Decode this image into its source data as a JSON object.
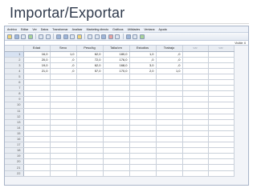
{
  "slide": {
    "title": "Importar/Exportar"
  },
  "app": {
    "menus": [
      "Archivo",
      "Editar",
      "Ver",
      "Datos",
      "Transformar",
      "Analizar",
      "Marketing directo",
      "Gráficos",
      "Utilidades",
      "Ventana",
      "Ayuda"
    ],
    "toolbar": [
      "open-icon",
      "save-icon",
      "print-icon",
      "dialog-recall-icon",
      "undo-icon",
      "redo-icon",
      "goto-case-icon",
      "goto-variable-icon",
      "variables-icon",
      "find-icon",
      "insert-cases-icon",
      "insert-variable-icon",
      "split-file-icon",
      "weight-cases-icon",
      "select-cases-icon",
      "value-labels-icon",
      "use-sets-icon",
      "show-all-icon"
    ],
    "visible_label": "Visible: 6 "
  },
  "grid": {
    "columns": [
      "Edad",
      "Sexo",
      "Peso/kg",
      "Talla/cm",
      "Estudios",
      "Trabajo",
      "var",
      "var"
    ],
    "rows": [
      [
        "16,0",
        "1,0",
        "62,0",
        "180,0",
        "1,0",
        ",0"
      ],
      [
        "20,0",
        ",0",
        "72,0",
        "176,0",
        ",0",
        ",0"
      ],
      [
        "19,0",
        ",0",
        "62,0",
        "168,0",
        "3,0",
        ",0"
      ],
      [
        "21,0",
        ",0",
        "57,0",
        "170,0",
        "2,0",
        "1,0"
      ]
    ],
    "row_numbers": [
      "1",
      "2",
      "3",
      "4",
      "5",
      "6",
      "7",
      "8",
      "9",
      "10",
      "11",
      "12",
      "13",
      "14",
      "15",
      "16",
      "17",
      "18",
      "19",
      "20",
      "21",
      "22"
    ]
  }
}
